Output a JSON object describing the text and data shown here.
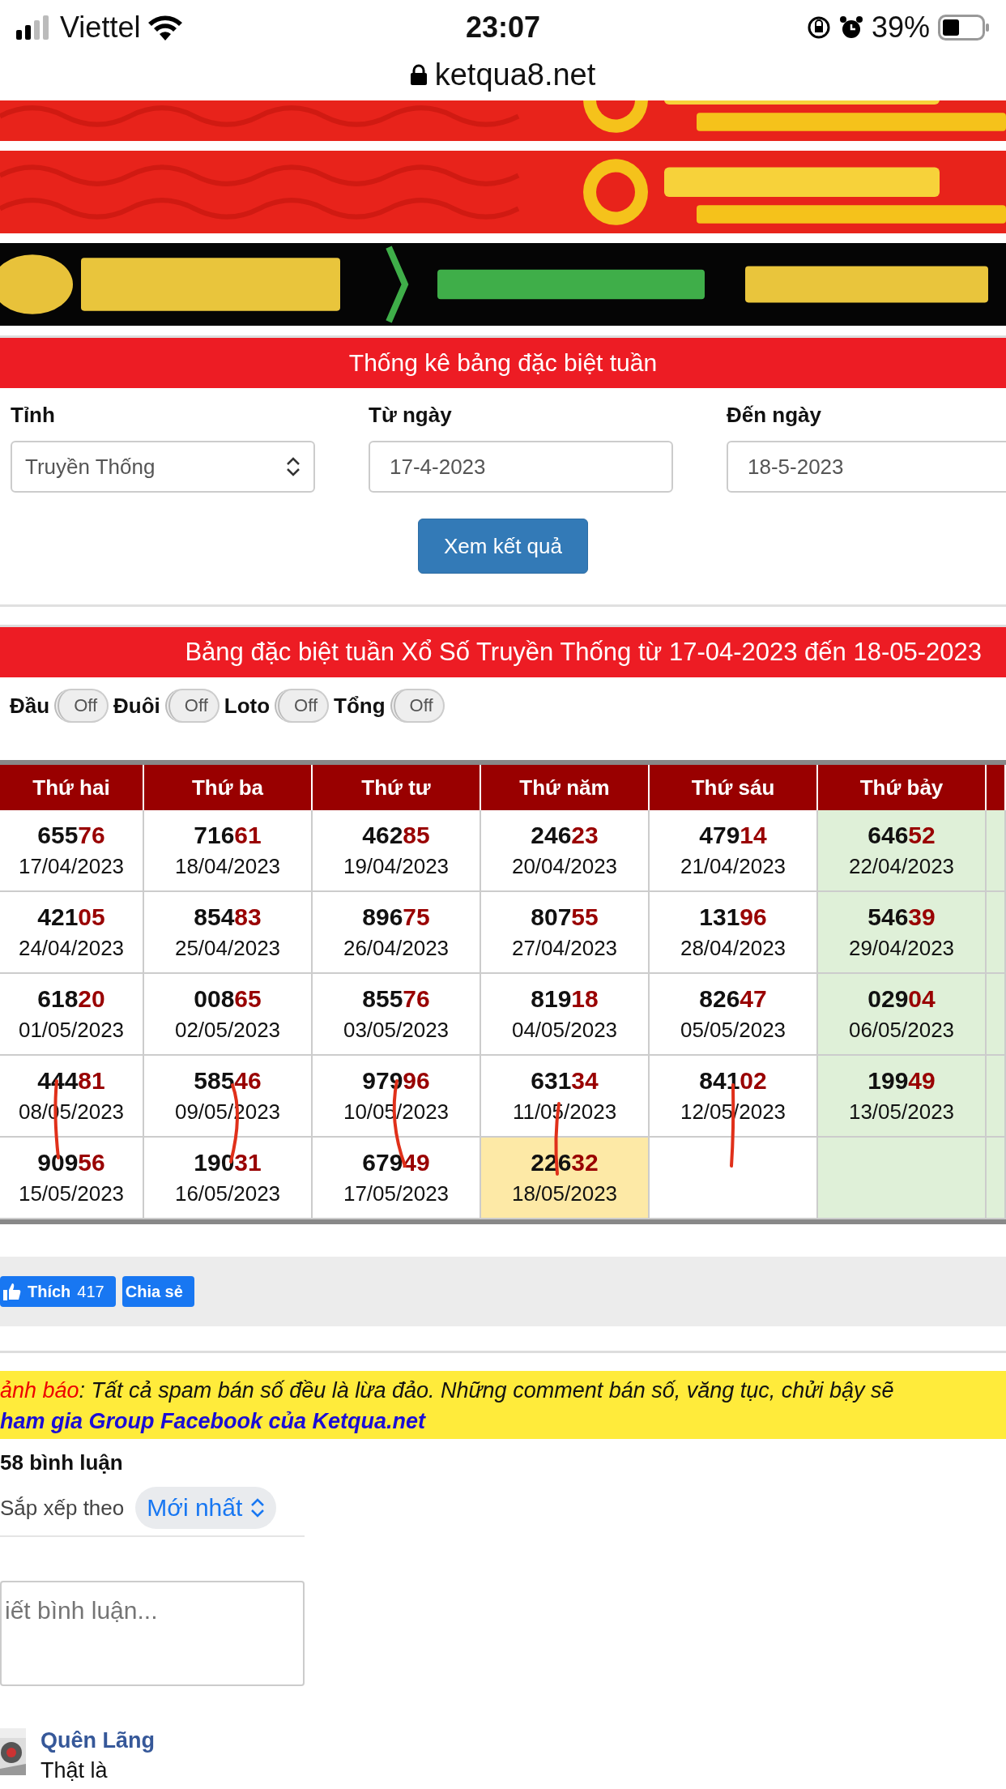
{
  "status_bar": {
    "carrier": "Viettel",
    "time": "23:07",
    "battery": "39%"
  },
  "address_bar": {
    "url": "ketqua8.net"
  },
  "filter": {
    "title": "Thống kê bảng đặc biệt tuần",
    "fields": [
      {
        "label": "Tỉnh",
        "kind": "select",
        "value": "Truyền Thống"
      },
      {
        "label": "Từ ngày",
        "kind": "input",
        "value": "17-4-2023"
      },
      {
        "label": "Đến ngày",
        "kind": "input",
        "value": "18-5-2023"
      }
    ],
    "button": "Xem kết quả"
  },
  "results": {
    "title": "Bảng đặc biệt tuần Xổ Số Truyền Thống từ 17-04-2023 đến 18-05-2023",
    "toggles": [
      {
        "label": "Đầu",
        "text": "Off",
        "on": false
      },
      {
        "label": "Đuôi",
        "text": "Off",
        "on": false
      },
      {
        "label": "Loto",
        "text": "Off",
        "on": false
      },
      {
        "label": "Tổng",
        "text": "Off",
        "on": false
      }
    ],
    "columns": [
      {
        "label": "Thứ hai",
        "shaded": false
      },
      {
        "label": "Thứ ba",
        "shaded": false
      },
      {
        "label": "Thứ tư",
        "shaded": false
      },
      {
        "label": "Thứ năm",
        "shaded": false
      },
      {
        "label": "Thứ sáu",
        "shaded": false
      },
      {
        "label": "Thứ bảy",
        "shaded": true
      },
      {
        "shaded": true
      }
    ],
    "rows": [
      [
        {
          "head": "655",
          "tail": "76",
          "date": "17/04/2023",
          "highlighted": false
        },
        {
          "head": "716",
          "tail": "61",
          "date": "18/04/2023",
          "highlighted": false
        },
        {
          "head": "462",
          "tail": "85",
          "date": "19/04/2023",
          "highlighted": false
        },
        {
          "head": "246",
          "tail": "23",
          "date": "20/04/2023",
          "highlighted": false
        },
        {
          "head": "479",
          "tail": "14",
          "date": "21/04/2023",
          "highlighted": false
        },
        {
          "head": "646",
          "tail": "52",
          "date": "22/04/2023",
          "highlighted": false
        },
        null
      ],
      [
        {
          "head": "421",
          "tail": "05",
          "date": "24/04/2023",
          "highlighted": false
        },
        {
          "head": "854",
          "tail": "83",
          "date": "25/04/2023",
          "highlighted": false
        },
        {
          "head": "896",
          "tail": "75",
          "date": "26/04/2023",
          "highlighted": false
        },
        {
          "head": "807",
          "tail": "55",
          "date": "27/04/2023",
          "highlighted": false
        },
        {
          "head": "131",
          "tail": "96",
          "date": "28/04/2023",
          "highlighted": false
        },
        {
          "head": "546",
          "tail": "39",
          "date": "29/04/2023",
          "highlighted": false
        },
        null
      ],
      [
        {
          "head": "618",
          "tail": "20",
          "date": "01/05/2023",
          "highlighted": false
        },
        {
          "head": "008",
          "tail": "65",
          "date": "02/05/2023",
          "highlighted": false
        },
        {
          "head": "855",
          "tail": "76",
          "date": "03/05/2023",
          "highlighted": false
        },
        {
          "head": "819",
          "tail": "18",
          "date": "04/05/2023",
          "highlighted": false
        },
        {
          "head": "826",
          "tail": "47",
          "date": "05/05/2023",
          "highlighted": false
        },
        {
          "head": "029",
          "tail": "04",
          "date": "06/05/2023",
          "highlighted": false
        },
        null
      ],
      [
        {
          "head": "444",
          "tail": "81",
          "date": "08/05/2023",
          "highlighted": false
        },
        {
          "head": "585",
          "tail": "46",
          "date": "09/05/2023",
          "highlighted": false
        },
        {
          "head": "979",
          "tail": "96",
          "date": "10/05/2023",
          "highlighted": false
        },
        {
          "head": "631",
          "tail": "34",
          "date": "11/05/2023",
          "highlighted": false
        },
        {
          "head": "841",
          "tail": "02",
          "date": "12/05/2023",
          "highlighted": false
        },
        {
          "head": "199",
          "tail": "49",
          "date": "13/05/2023",
          "highlighted": false
        },
        null
      ],
      [
        {
          "head": "909",
          "tail": "56",
          "date": "15/05/2023",
          "highlighted": false
        },
        {
          "head": "190",
          "tail": "31",
          "date": "16/05/2023",
          "highlighted": false
        },
        {
          "head": "679",
          "tail": "49",
          "date": "17/05/2023",
          "highlighted": false
        },
        {
          "head": "226",
          "tail": "32",
          "date": "18/05/2023",
          "highlighted": true
        },
        null,
        null,
        null
      ]
    ]
  },
  "social": {
    "like": "Thích",
    "like_count": "417",
    "share": "Chia sẻ"
  },
  "notice": {
    "text": "ảnh báo",
    "rest": ": Tất cả spam bán số đều là lừa đảo. Những comment bán số, văng tục, chửi bậy sẽ",
    "link": "ham gia Group Facebook của Ketqua.net"
  },
  "comments": {
    "count": "58 bình luận",
    "sort_label": "Sắp xếp theo",
    "sort_value": "Mới nhất",
    "placeholder": "iết bình luận...",
    "items": [
      {
        "author": "Quên Lãng",
        "text": "Thật là"
      }
    ]
  }
}
